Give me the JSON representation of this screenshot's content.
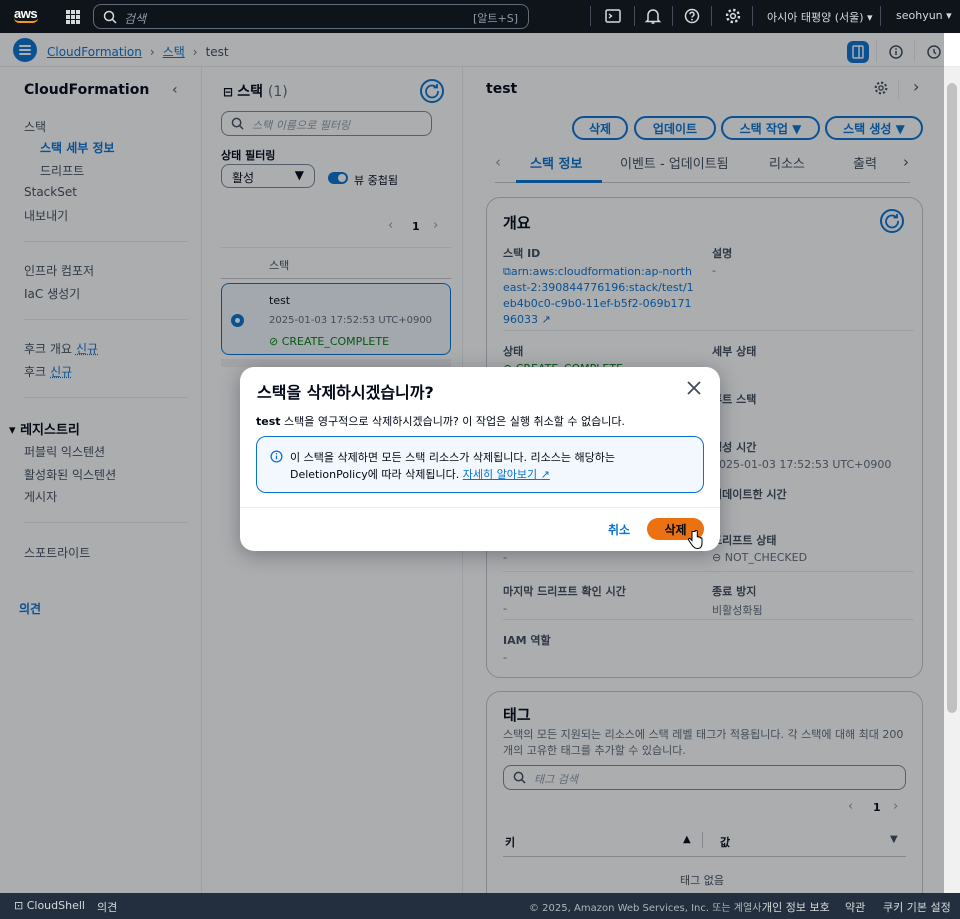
{
  "topnav": {
    "logo": "aws",
    "search_placeholder": "검색",
    "search_shortcut": "[알트+S]",
    "icons": [
      "cloudshell-icon",
      "bell-icon",
      "help-icon",
      "gear-icon"
    ],
    "region": "아시아 태평양 (서울) ▾",
    "user": "seohyun ▾"
  },
  "breadcrumb": {
    "items": [
      "CloudFormation",
      "스택",
      "test"
    ]
  },
  "leftnav": {
    "title": "CloudFormation",
    "items": [
      {
        "label": "스택"
      },
      {
        "label": "스택 세부 정보"
      },
      {
        "label": "드리프트"
      },
      {
        "label": "StackSet"
      },
      {
        "label": "내보내기"
      },
      {
        "label": "인프라 컴포저"
      },
      {
        "label": "IaC 생성기"
      },
      {
        "label": "후크 개요",
        "badge": "신규"
      },
      {
        "label": "후크",
        "badge": "신규"
      },
      {
        "label": "레지스트리"
      },
      {
        "label": "퍼블릭 익스텐션"
      },
      {
        "label": "활성화된 익스텐션"
      },
      {
        "label": "게시자"
      },
      {
        "label": "스포트라이트"
      },
      {
        "label": "의견"
      }
    ]
  },
  "list": {
    "title": "스택",
    "count": "(1)",
    "filter_placeholder": "스택 이름으로 필터링",
    "status_filter_label": "상태 필터링",
    "status_value": "활성",
    "nested_label": "뷰 중첩됨",
    "page": "1",
    "column": "스택",
    "stack": {
      "name": "test",
      "date": "2025-01-03 17:52:53 UTC+0900",
      "status": "CREATE_COMPLETE"
    }
  },
  "detail": {
    "title": "test",
    "buttons": [
      "삭제",
      "업데이트",
      "스택 작업 ▼",
      "스택 생성 ▼"
    ],
    "tabs": [
      "스택 정보",
      "이벤트 - 업데이트됨",
      "리소스",
      "출력"
    ],
    "overview": {
      "title": "개요",
      "stack_id_label": "스택 ID",
      "stack_id_value": "arn:aws:cloudformation:ap-northeast-2:390844776196:stack/test/1eb4b0c0-c9b0-11ef-b5f2-069b17196033",
      "desc_label": "설명",
      "desc_value": "-",
      "status_label": "상태",
      "status_value": "CREATE_COMPLETE",
      "detail_status_label": "세부 상태",
      "root_stack_label": "루트 스택",
      "created_label": "생성 시간",
      "created_value": "2025-01-03 17:52:53 UTC+0900",
      "updated_label": "업데이트한 시간",
      "drift_label": "드리프트 상태",
      "drift_value": "NOT_CHECKED",
      "drift_dash": "-",
      "last_drift_label": "마지막 드리프트 확인 시간",
      "last_drift_value": "-",
      "termination_label": "종료 방지",
      "termination_value": "비활성화됨",
      "iam_label": "IAM 역할",
      "iam_value": "-"
    },
    "tags": {
      "title": "태그",
      "desc": "스택의 모든 지원되는 리소스에 스택 레벨 태그가 적용됩니다. 각 스택에 대해 최대 200개의 고유한 태그를 추가할 수 있습니다.",
      "search_placeholder": "태그 검색",
      "page": "1",
      "col_key": "키",
      "col_value": "값",
      "empty": "태그 없음"
    }
  },
  "modal": {
    "title": "스택을 삭제하시겠습니까?",
    "body_bold": "test",
    "body": " 스택을 영구적으로 삭제하시겠습니까? 이 작업은 실행 취소할 수 없습니다.",
    "alert_line1": "이 스택을 삭제하면 모든 스택 리소스가 삭제됩니다. 리소스는 해당하는",
    "alert_line2": "DeletionPolicy에 따라 삭제됩니다.",
    "alert_link": "자세히 알아보기",
    "cancel": "취소",
    "delete": "삭제"
  },
  "footer": {
    "cloudshell": "CloudShell",
    "feedback": "의견",
    "copyright": "© 2025, Amazon Web Services, Inc. 또는 계열사.",
    "privacy": "개인 정보 보호",
    "terms": "약관",
    "cookies": "쿠키 기본 설정"
  },
  "colors": {
    "accent": "#0972d3",
    "success": "#037f0c",
    "primary_button": "#ec7211",
    "nav_bg": "#0f141a"
  }
}
